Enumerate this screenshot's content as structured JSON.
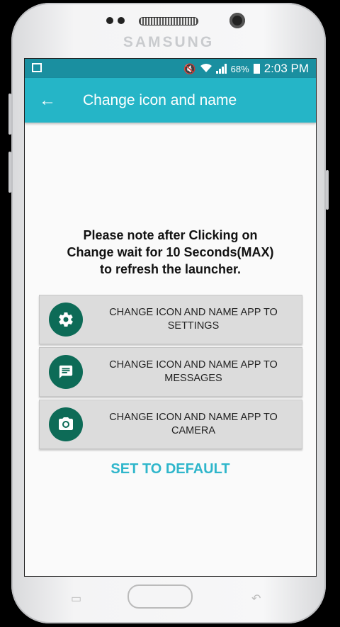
{
  "device": {
    "brand": "SAMSUNG"
  },
  "status_bar": {
    "battery": "68%",
    "time": "2:03 PM"
  },
  "app_bar": {
    "back_icon": "arrow-left-icon",
    "title": "Change icon and name"
  },
  "note": {
    "line1": "Please note after Clicking on",
    "line2": "Change wait for 10 Seconds(MAX)",
    "line3": "to refresh the launcher."
  },
  "options": [
    {
      "line1": "CHANGE ICON AND NAME APP TO",
      "line2": "SETTINGS",
      "icon": "gear-icon"
    },
    {
      "line1": "CHANGE ICON AND NAME APP TO",
      "line2": "MESSAGES",
      "icon": "message-icon"
    },
    {
      "line1": "CHANGE ICON AND NAME APP TO",
      "line2": "CAMERA",
      "icon": "camera-icon"
    }
  ],
  "reset_label": "SET TO DEFAULT",
  "colors": {
    "app_bar": "#25b5c7",
    "status_bar": "#1a8fa0",
    "icon_circle": "#0d6b57",
    "accent_text": "#2fb6cb"
  }
}
